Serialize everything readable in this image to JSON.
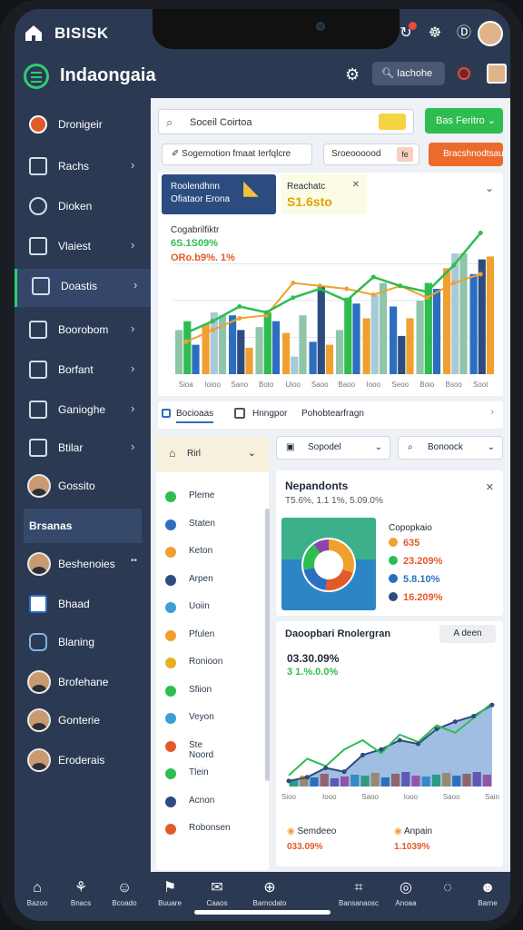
{
  "status": {
    "brand": "BISISK"
  },
  "appbar": {
    "title": "Indaongaia",
    "search_label": "Iachohe"
  },
  "sidebar": {
    "items": [
      {
        "label": "Dronigeir"
      },
      {
        "label": "Rachs"
      },
      {
        "label": "Dioken"
      },
      {
        "label": "Vlaiest"
      },
      {
        "label": "Doastis"
      },
      {
        "label": "Boorobom"
      },
      {
        "label": "Borfant"
      },
      {
        "label": "Ganioghe"
      },
      {
        "label": "Btilar"
      },
      {
        "label": "Gossito"
      }
    ],
    "section": "Brsanas",
    "people": [
      {
        "label": "Beshenoies"
      },
      {
        "label": "Bhaad"
      },
      {
        "label": "Blaning"
      },
      {
        "label": "Brofehane"
      },
      {
        "label": "Gonterie"
      },
      {
        "label": "Eroderais"
      }
    ]
  },
  "toolbar": {
    "search_text": "Soceil Coirtoa",
    "primary_button": "Bas Feritro",
    "filter_chip": "Sogemotion fmaat Ierfqlcre",
    "select_chip": "Sroeoooood",
    "select_value": "fe",
    "action_button": "Bracshnodtsau"
  },
  "summary": {
    "navy_title": "Roolendhnn",
    "navy_sub": "Ofiataor Erona",
    "yellow_title": "Reachatc",
    "yellow_value": "S1.6sto"
  },
  "chart_labels": {
    "title": "Cogabrilfiktr",
    "val1": "6S.1S09%",
    "val2": "ORo.b9%. 1%"
  },
  "chart_data": {
    "type": "bar",
    "categories": [
      "Sioa",
      "Ioioo",
      "Sano",
      "Boto",
      "Uioo",
      "Saoo",
      "Baoo",
      "Iooo",
      "Seoo",
      "Boio",
      "Bsoo",
      "Soot"
    ],
    "ylim": [
      0,
      100
    ],
    "series": [
      {
        "values": [
          30,
          34,
          40,
          32,
          28,
          22,
          30,
          38,
          46,
          50,
          72,
          68
        ]
      },
      {
        "values": [
          36,
          42,
          30,
          42,
          12,
          60,
          52,
          54,
          26,
          62,
          82,
          78
        ]
      },
      {
        "values": [
          20,
          40,
          18,
          36,
          40,
          20,
          48,
          62,
          38,
          58,
          82,
          80
        ]
      }
    ],
    "line_values": [
      28,
      36,
      46,
      42,
      52,
      58,
      50,
      66,
      60,
      56,
      74,
      96
    ],
    "line2_values": [
      22,
      30,
      38,
      40,
      62,
      60,
      58,
      54,
      60,
      52,
      62,
      68
    ],
    "legend": "none"
  },
  "tabs": {
    "tab1": "Bocioaas",
    "tab2": "Hnngpor",
    "tab3": "Pohobtearfragn"
  },
  "dropdowns": {
    "left": "Rirl",
    "mid": "Sopodel",
    "right": "Bonoock"
  },
  "list": [
    {
      "label": "Pleme",
      "color": "#2ebd4f"
    },
    {
      "label": "Staten",
      "color": "#2c6fbf"
    },
    {
      "label": "Keton",
      "color": "#f0a030"
    },
    {
      "label": "Arpen",
      "color": "#2c4c80"
    },
    {
      "label": "Uoiin",
      "color": "#3aa0d0"
    },
    {
      "label": "Pfulen",
      "color": "#f0a030"
    },
    {
      "label": "Ronioon",
      "color": "#e8b020"
    },
    {
      "label": "Sfiion",
      "color": "#2ebd4f"
    },
    {
      "label": "Veyon",
      "color": "#3aa0d0"
    },
    {
      "label": "Ste Noord",
      "color": "#e35a2a"
    },
    {
      "label": "Tlein",
      "color": "#2ebd4f"
    },
    {
      "label": "Acnon",
      "color": "#2c4c80"
    },
    {
      "label": "Robonsen",
      "color": "#e35a2a"
    }
  ],
  "card1": {
    "title": "Nepandonts",
    "subtitle": "T5.6%, 1.1 1%, 5.09.0%",
    "legend_title": "Copopkaio",
    "rows": [
      {
        "label": "635",
        "color": "#f0a030"
      },
      {
        "label": "23.209%",
        "color": "#2ebd4f"
      },
      {
        "label": "5.8.10%",
        "color": "#2c6fbf"
      },
      {
        "label": "16.209%",
        "color": "#2c4c80"
      }
    ],
    "donut": [
      {
        "value": 30,
        "color": "#f0a030"
      },
      {
        "value": 22,
        "color": "#e35a2a"
      },
      {
        "value": 20,
        "color": "#2c6fbf"
      },
      {
        "value": 18,
        "color": "#2ebd4f"
      },
      {
        "value": 10,
        "color": "#8e44ad"
      }
    ]
  },
  "card2": {
    "title": "Daoopbari Rnolergran",
    "button": "A deen",
    "value1": "03.30.09%",
    "value2": "3 1.%.0.0%",
    "x_labels": [
      "Sioo",
      "Iooo",
      "Saoo",
      "Iooo",
      "Saoo",
      "Sain"
    ],
    "area_values": [
      6,
      10,
      20,
      16,
      34,
      40,
      50,
      46,
      62,
      70,
      76,
      88
    ],
    "line_values": [
      12,
      30,
      22,
      40,
      50,
      36,
      56,
      48,
      66,
      58,
      74,
      90
    ],
    "bars": [
      8,
      12,
      10,
      14,
      9,
      11,
      13,
      12,
      15,
      10,
      14,
      16,
      12,
      11,
      13,
      15,
      12,
      14,
      16,
      13
    ],
    "footer": [
      {
        "label": "Semdeeo",
        "value": "033.09%",
        "color": "#f0a030"
      },
      {
        "label": "Anpain",
        "value": "1.1039%",
        "color": "#f0a030"
      }
    ]
  },
  "bottomnav": [
    {
      "label": "Bazoo"
    },
    {
      "label": "Bnacs"
    },
    {
      "label": "Bcoado"
    },
    {
      "label": "Buuare"
    },
    {
      "label": "Caaos"
    },
    {
      "label": "Barnodato"
    },
    {
      "label": "Bansanaosc"
    },
    {
      "label": "Anoaa"
    },
    {
      "label": ""
    },
    {
      "label": "Barne"
    }
  ]
}
